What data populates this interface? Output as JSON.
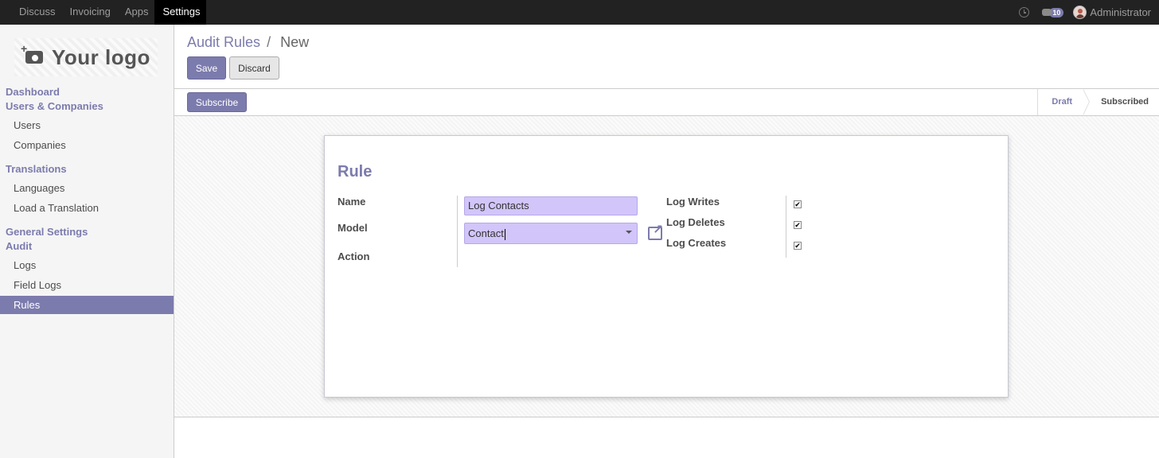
{
  "topbar": {
    "menu": [
      "Discuss",
      "Invoicing",
      "Apps",
      "Settings"
    ],
    "active_menu": "Settings",
    "chat_count": "10",
    "user_name": "Administrator"
  },
  "logo": {
    "text": "Your logo"
  },
  "sidebar": {
    "dashboard": "Dashboard",
    "users_companies": "Users & Companies",
    "users": "Users",
    "companies": "Companies",
    "translations": "Translations",
    "languages": "Languages",
    "load_translation": "Load a Translation",
    "general_settings": "General Settings",
    "audit": "Audit",
    "logs": "Logs",
    "field_logs": "Field Logs",
    "rules": "Rules"
  },
  "breadcrumb": {
    "parent": "Audit Rules",
    "separator": "/",
    "current": "New"
  },
  "buttons": {
    "save": "Save",
    "discard": "Discard",
    "subscribe": "Subscribe"
  },
  "status": {
    "draft": "Draft",
    "subscribed": "Subscribed"
  },
  "form": {
    "title": "Rule",
    "name_label": "Name",
    "name_value": "Log Contacts",
    "model_label": "Model",
    "model_value": "Contact",
    "action_label": "Action",
    "log_writes_label": "Log Writes",
    "log_deletes_label": "Log Deletes",
    "log_creates_label": "Log Creates",
    "log_writes": true,
    "log_deletes": true,
    "log_creates": true
  },
  "colors": {
    "accent": "#7c7bad",
    "input_bg": "#d2c5fa",
    "navbar": "#222222"
  }
}
